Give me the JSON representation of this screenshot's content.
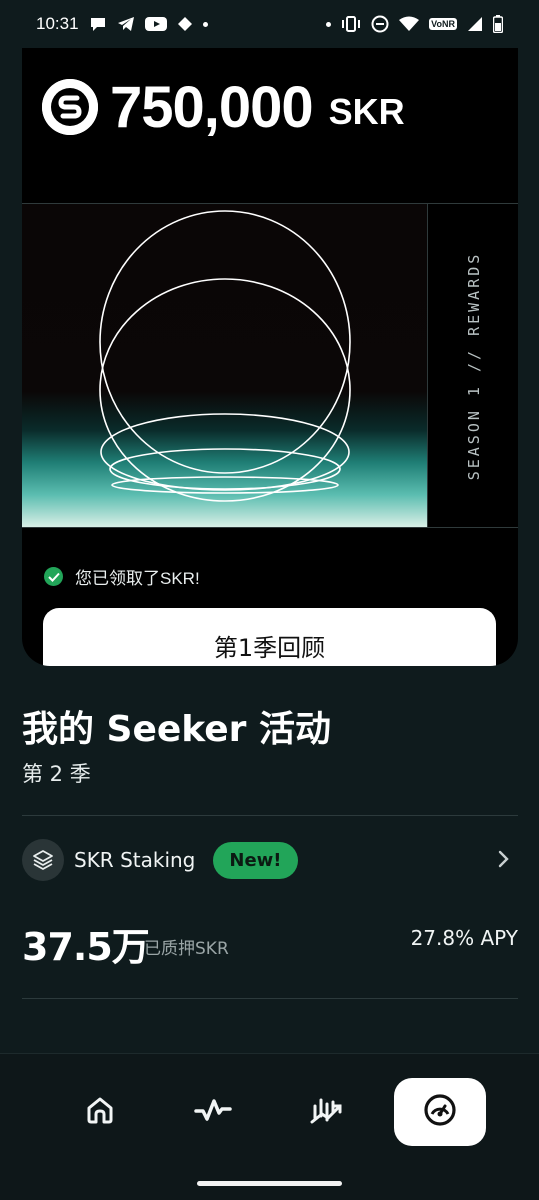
{
  "status_bar": {
    "time": "10:31",
    "network_badge": "VoNR"
  },
  "rewards_card": {
    "amount": "750,000",
    "unit": "SKR",
    "season_label": "SEASON 1 // REWARDS",
    "claimed_text": "您已领取了SKR!",
    "recap_button_label": "第1季回顾"
  },
  "activity": {
    "title": "我的 Seeker 活动",
    "subtitle": "第 2 季",
    "staking": {
      "label": "SKR Staking",
      "badge": "New!",
      "staked_value": "37.5万",
      "staked_label": "已质押SKR",
      "apy": "27.8% APY"
    }
  },
  "bottom_nav": {
    "items": [
      "home-icon",
      "activity-icon",
      "trade-icon",
      "dashboard-icon"
    ],
    "selected": "dashboard-icon"
  },
  "colors": {
    "background": "#0f1b1d",
    "accent_green": "#22a559",
    "card": "#000000",
    "button": "#ffffff"
  }
}
